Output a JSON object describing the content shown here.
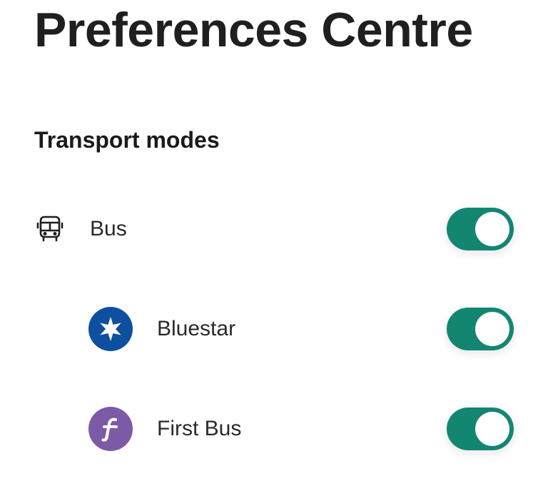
{
  "page": {
    "title": "Preferences Centre"
  },
  "section": {
    "heading": "Transport modes"
  },
  "items": [
    {
      "label": "Bus",
      "icon": "bus-icon",
      "enabled": true
    },
    {
      "label": "Bluestar",
      "icon": "bluestar-logo-icon",
      "enabled": true
    },
    {
      "label": "First Bus",
      "icon": "first-bus-logo-icon",
      "enabled": true
    }
  ],
  "colors": {
    "toggle_on": "#138672",
    "bluestar": "#0f4fa0",
    "first_bus": "#7c5aa6"
  }
}
